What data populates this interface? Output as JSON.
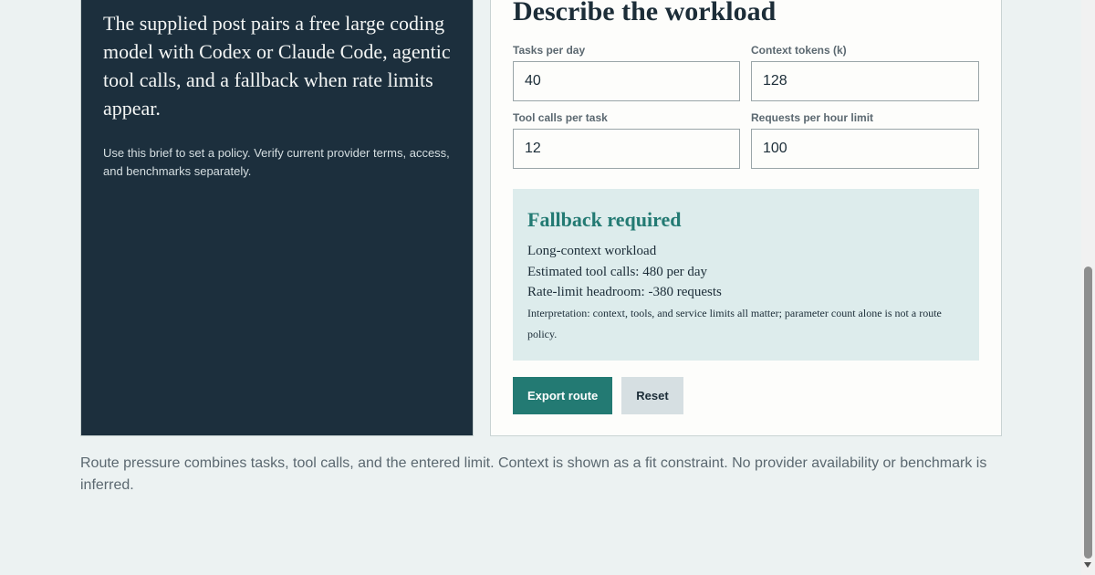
{
  "brief": {
    "lead": "The supplied post pairs a free large coding model with Codex or Claude Code, agentic tool calls, and a fallback when rate limits appear.",
    "note": "Use this brief to set a policy. Verify current provider terms, access, and benchmarks separately."
  },
  "form": {
    "title": "Describe the workload",
    "fields": [
      {
        "label": "Tasks per day",
        "value": "40"
      },
      {
        "label": "Context tokens (k)",
        "value": "128"
      },
      {
        "label": "Tool calls per task",
        "value": "12"
      },
      {
        "label": "Requests per hour limit",
        "value": "100"
      }
    ]
  },
  "result": {
    "title": "Fallback required",
    "lines": [
      "Long-context workload",
      "Estimated tool calls: 480 per day",
      "Rate-limit headroom: -380 requests"
    ],
    "interpretation": "Interpretation: context, tools, and service limits all matter; parameter count alone is not a route policy."
  },
  "actions": {
    "export_label": "Export route",
    "reset_label": "Reset"
  },
  "footer": {
    "note": "Route pressure combines tasks, tool calls, and the entered limit. Context is shown as a fit constraint. No provider availability or benchmark is inferred."
  },
  "colors": {
    "dark_panel": "#1c2f3d",
    "accent": "#237a73",
    "result_bg": "#ddecec",
    "page_bg": "#ecf2f2"
  }
}
